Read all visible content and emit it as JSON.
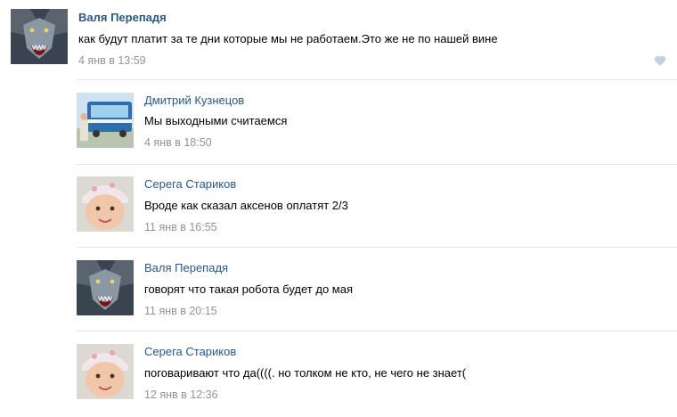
{
  "post": {
    "author": "Валя Перепадя",
    "text": "как будут платит за те дни которые мы не работаем.Это же не по нашей вине",
    "date": "4 янв в 13:59"
  },
  "replies": [
    {
      "author": "Дмитрий Кузнецов",
      "text": "Мы выходными считаемся",
      "date": "4 янв в 18:50"
    },
    {
      "author": "Серега Стариков",
      "text": "Вроде как сказал аксенов оплатят 2/3",
      "date": "11 янв в 16:55"
    },
    {
      "author": "Валя Перепадя",
      "text": "говорят что такая робота будет до мая",
      "date": "11 янв в 20:15"
    },
    {
      "author": "Серега Стариков",
      "text": "поговаривают что да((((. но толком не кто, не чего не знает(",
      "date": "12 янв в 12:36"
    }
  ],
  "icons": {
    "like": "heart-icon"
  },
  "colors": {
    "link": "#2a5885",
    "muted": "#939393",
    "divider": "#e7e8ec",
    "like": "#c5d0db"
  }
}
